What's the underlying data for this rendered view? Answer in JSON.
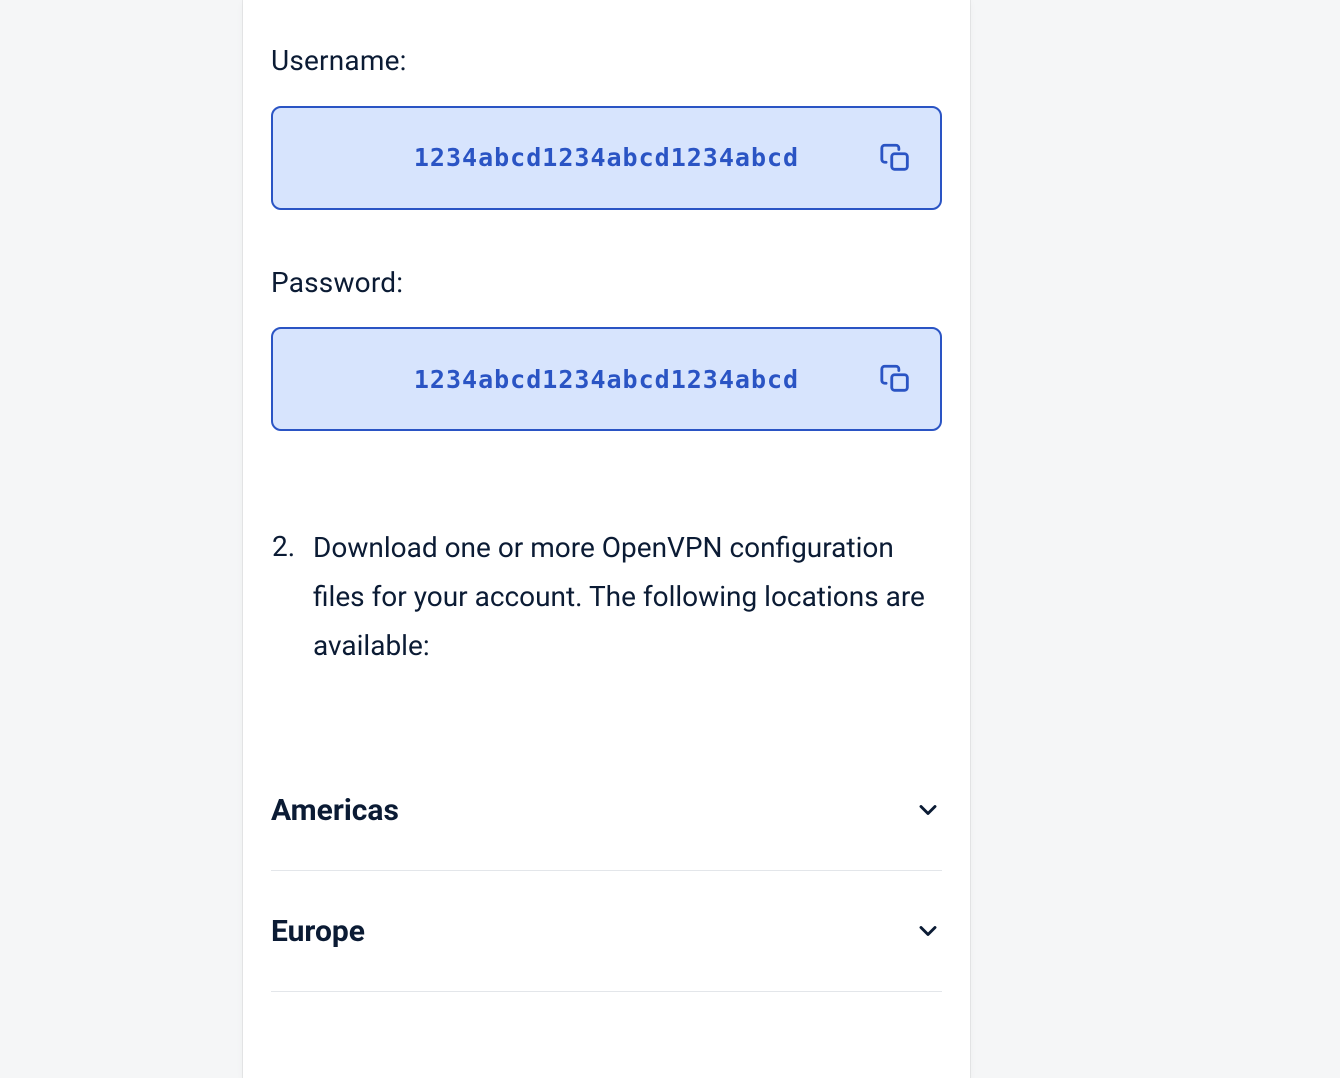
{
  "credentials": {
    "username_label": "Username:",
    "username_value": "1234abcd1234abcd1234abcd",
    "password_label": "Password:",
    "password_value": "1234abcd1234abcd1234abcd"
  },
  "step": {
    "index": "2.",
    "text": "Download one or more OpenVPN configuration files for your account. The following locations are available:"
  },
  "regions": [
    {
      "title": "Americas"
    },
    {
      "title": "Europe"
    }
  ]
}
